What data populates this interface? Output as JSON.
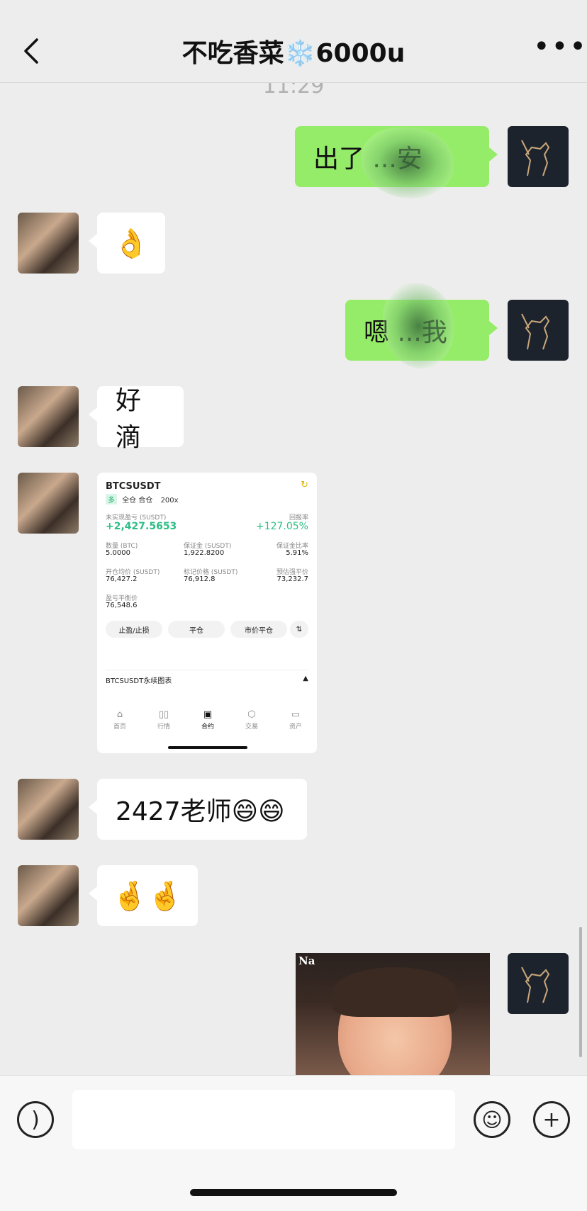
{
  "header": {
    "title": "不吃香菜❄️6000u"
  },
  "timestamp": "11:29",
  "messages": {
    "m1_text": "出了 ...安",
    "m2_emoji": "👌",
    "m3_text": "嗯 ...我",
    "m4_text": "好滴",
    "m6_text": "2427老师😄😄",
    "m7_emoji": "🤞🤞"
  },
  "card": {
    "symbol": "BTCSUSDT",
    "tag_s": "多",
    "tag_mode": "全仓 合仓",
    "leverage": "200x",
    "pnl_label": "未实现盈亏 (SUSDT)",
    "pnl_value": "+2,427.5653",
    "roe_label": "回报率",
    "roe_value": "+127.05%",
    "qty_label": "数量 (BTC)",
    "qty_value": "5.0000",
    "margin_label": "保证金 (SUSDT)",
    "margin_value": "1,922.8200",
    "margin_ratio_label": "保证金比率",
    "margin_ratio_value": "5.91%",
    "entry_label": "开仓均价 (SUSDT)",
    "entry_value": "76,427.2",
    "mark_label": "标记价格 (SUSDT)",
    "mark_value": "76,912.8",
    "liq_label": "预估强平价",
    "liq_value": "73,232.7",
    "breakeven_label": "盈亏平衡价",
    "breakeven_value": "76,548.6",
    "btn_tpsl": "止盈/止损",
    "btn_close": "平仓",
    "btn_market_close": "市价平仓",
    "chart_label": "BTCSUSDT永续图表",
    "nav": [
      "首页",
      "行情",
      "合约",
      "交易",
      "资产"
    ]
  },
  "sticker_text": "Na",
  "input": {
    "placeholder": ""
  }
}
